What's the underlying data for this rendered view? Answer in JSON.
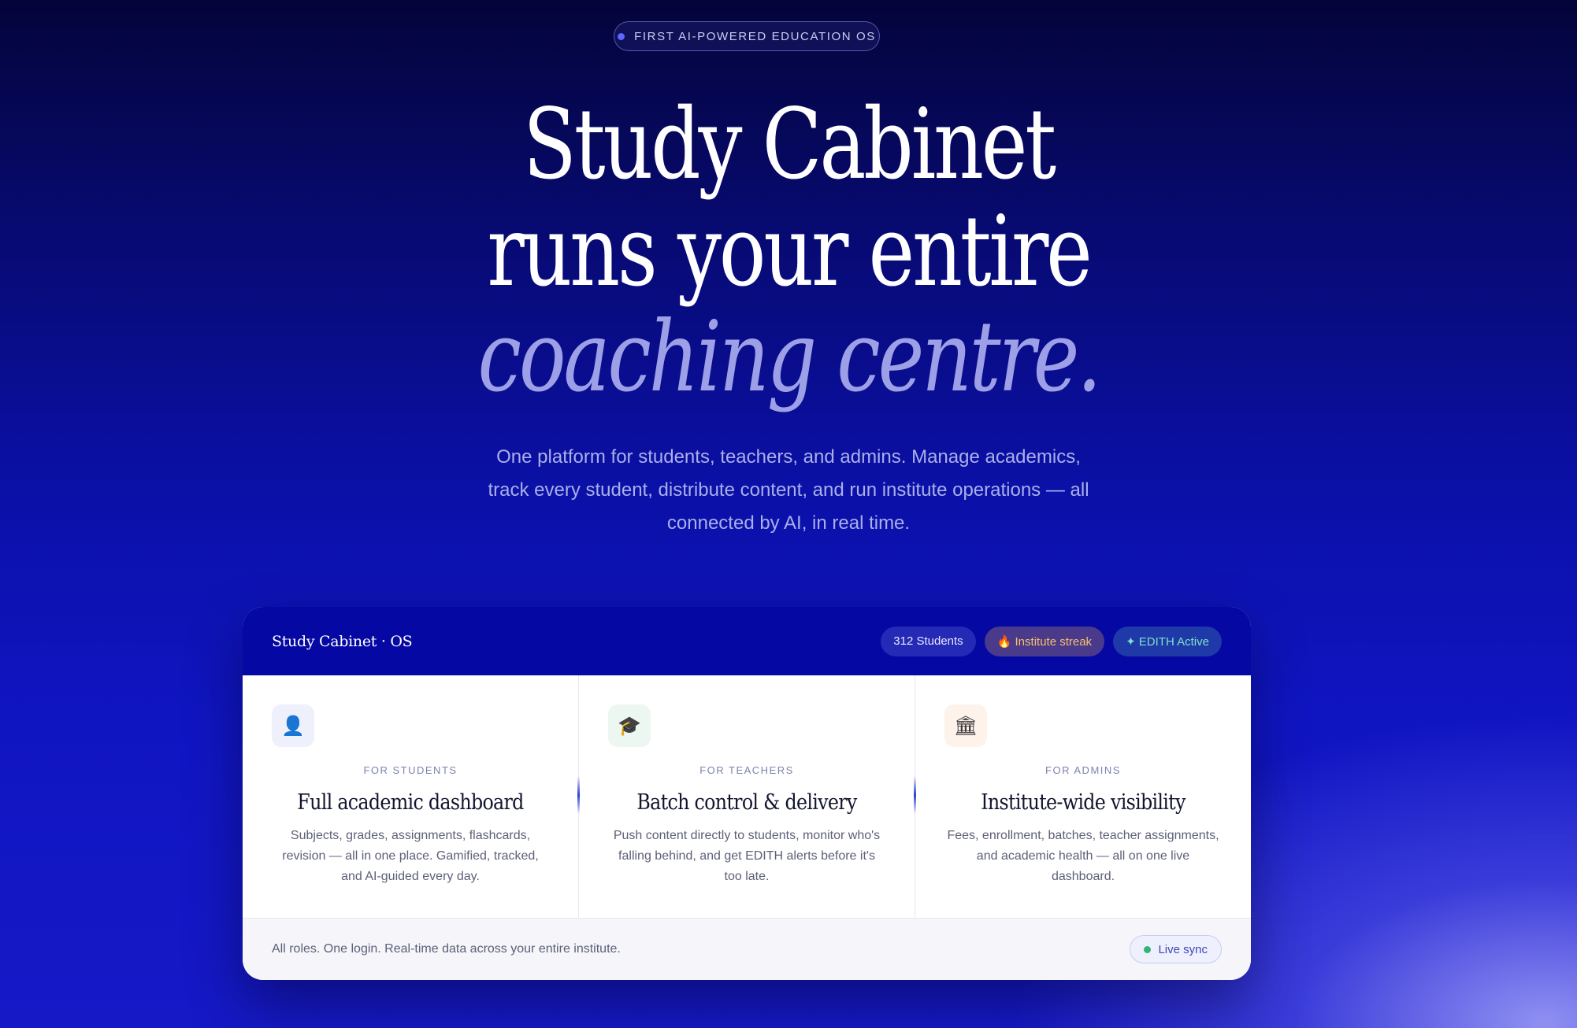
{
  "hero": {
    "eyebrow": "FIRST AI-POWERED EDUCATION OS",
    "headline_line1": "Study Cabinet",
    "headline_line2": "runs your entire",
    "headline_line3": "coaching centre.",
    "subtext": "One platform for students, teachers, and admins. Manage academics, track every student, distribute content, and run institute operations — all connected by AI, in real time."
  },
  "preview": {
    "brand": "Study Cabinet · OS",
    "badges": {
      "students": "312 Students",
      "streak": "🔥 Institute streak",
      "edith": "✦ EDITH Active"
    },
    "columns": [
      {
        "icon": "person-icon",
        "icon_glyph": "👤",
        "eyebrow": "FOR STUDENTS",
        "title": "Full academic dashboard",
        "desc": "Subjects, grades, assignments, flashcards, revision — all in one place. Gamified, tracked, and AI-guided every day."
      },
      {
        "icon": "graduation-cap-icon",
        "icon_glyph": "🎓",
        "eyebrow": "FOR TEACHERS",
        "title": "Batch control & delivery",
        "desc": "Push content directly to students, monitor who's falling behind, and get EDITH alerts before it's too late."
      },
      {
        "icon": "institution-icon",
        "icon_glyph": "🏛",
        "eyebrow": "FOR ADMINS",
        "title": "Institute-wide visibility",
        "desc": "Fees, enrollment, batches, teacher assignments, and academic health — all on one live dashboard."
      }
    ],
    "footer_text": "All roles. One login. Real-time data across your entire institute.",
    "live_label": "Live sync"
  },
  "colors": {
    "accent": "#5b67ff",
    "card_header": "#0508a3",
    "live_dot": "#2fb574"
  }
}
